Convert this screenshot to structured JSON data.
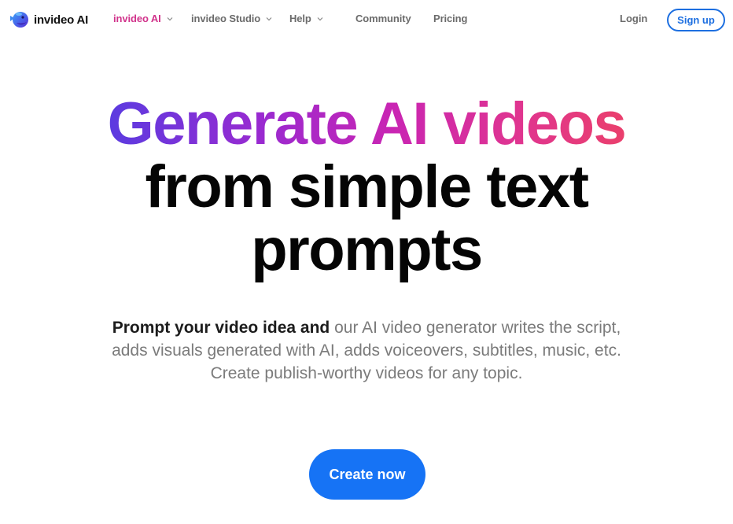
{
  "brand": {
    "name": "invideo AI",
    "logo_icon": "fish-mascot-icon",
    "colors": {
      "accent_pink": "#d1338b",
      "primary_blue": "#1673f5",
      "outline_blue": "#1d6fe0",
      "gradient_start": "#5b3be0",
      "gradient_end": "#ea3f6c",
      "nav_text": "#6b6b6b"
    }
  },
  "nav": {
    "items": [
      {
        "label": "invideo AI",
        "has_dropdown": true,
        "active": true
      },
      {
        "label": "invideo Studio",
        "has_dropdown": true,
        "active": false
      },
      {
        "label": "Help",
        "has_dropdown": true,
        "active": false
      },
      {
        "label": "Community",
        "has_dropdown": false,
        "active": false
      },
      {
        "label": "Pricing",
        "has_dropdown": false,
        "active": false
      }
    ],
    "login_label": "Login",
    "signup_label": "Sign up"
  },
  "hero": {
    "title_gradient": "Generate AI videos",
    "title_line2": "from simple text",
    "title_line3": "prompts",
    "subtitle_strong": "Prompt your video idea and",
    "subtitle_rest": " our AI video generator writes the script, adds visuals generated with AI, adds voiceovers, subtitles, music, etc. Create publish-worthy videos for any topic.",
    "cta_label": "Create now"
  }
}
